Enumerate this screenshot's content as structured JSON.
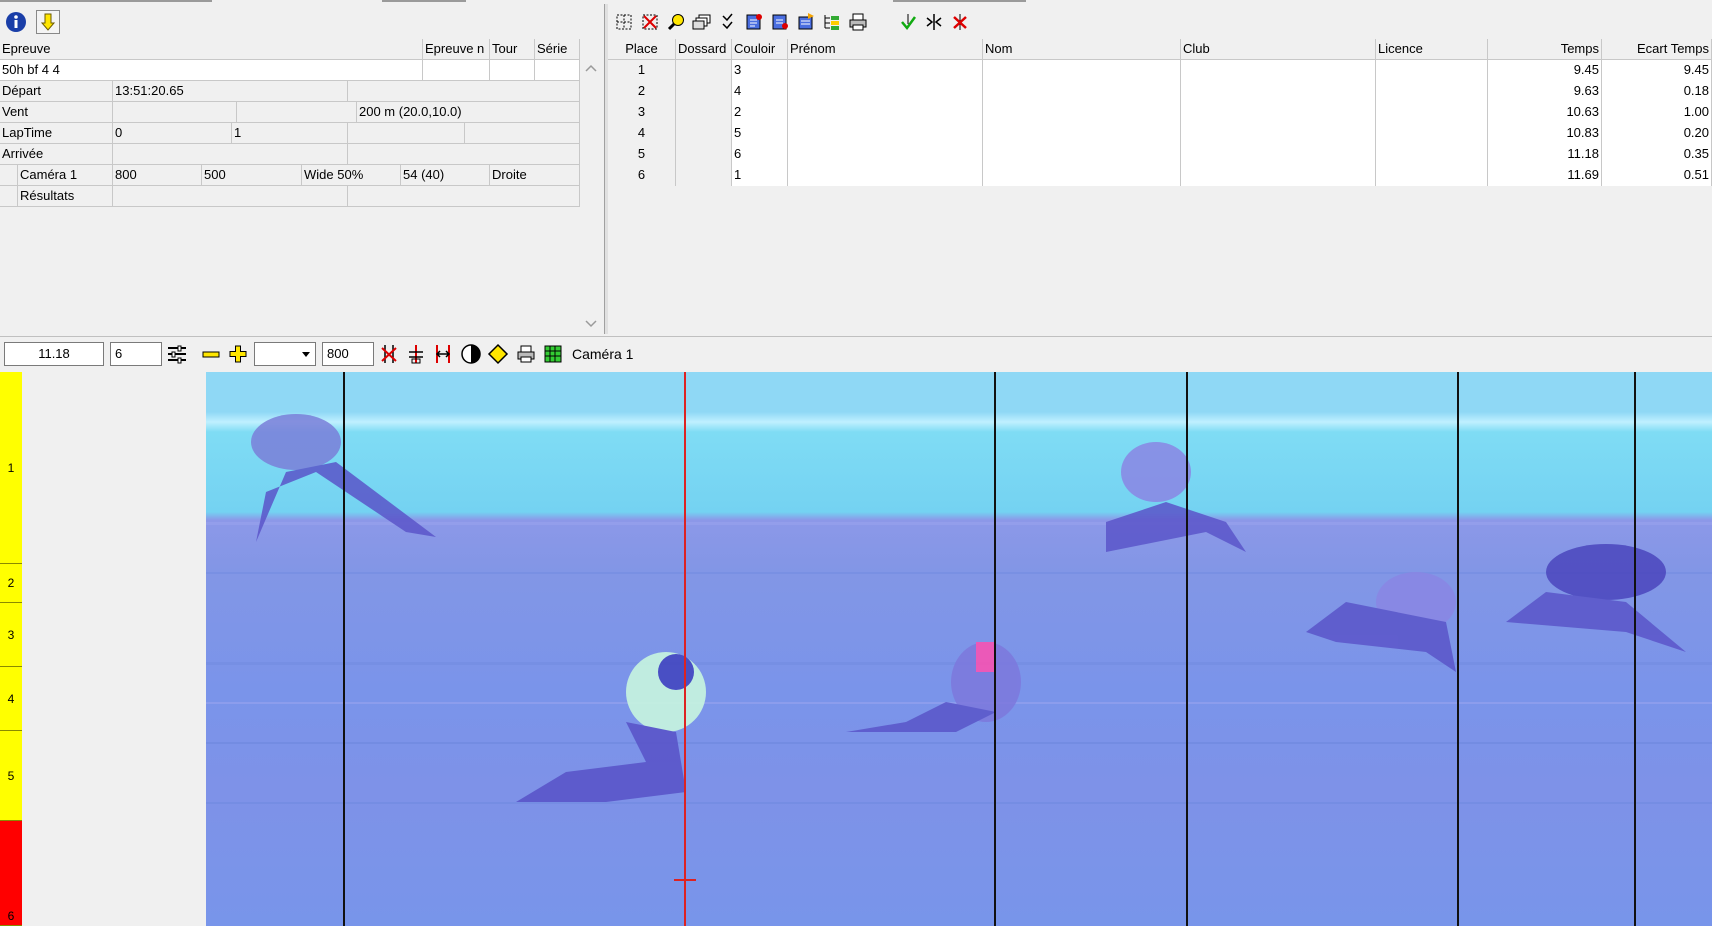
{
  "event_panel": {
    "toolbar": {
      "info_icon": "info-icon",
      "down_icon": "arrow-down-icon"
    },
    "headers": [
      "Epreuve",
      "Epreuve n",
      "Tour",
      "Série"
    ],
    "event_name": "50h bf 4 4",
    "rows": {
      "depart": {
        "label": "Départ",
        "value": "13:51:20.65"
      },
      "vent": {
        "label": "Vent",
        "value": "200 m (20.0,10.0)"
      },
      "laptime": {
        "label": "LapTime",
        "v1": "0",
        "v2": "1"
      },
      "arrivee": {
        "label": "Arrivée"
      },
      "camera": {
        "label": "Caméra 1",
        "v1": "800",
        "v2": "500",
        "v3": "Wide 50%",
        "v4": "54  (40)",
        "v5": "Droite"
      },
      "resultats": {
        "label": "Résultats"
      }
    }
  },
  "results_panel": {
    "headers": [
      "Place",
      "Dossard",
      "Couloir",
      "Prénom",
      "Nom",
      "Club",
      "Licence",
      "Temps",
      "Ecart Temps"
    ],
    "rows": [
      {
        "place": "1",
        "dossard": "",
        "couloir": "3",
        "prenom": "",
        "nom": "",
        "club": "",
        "licence": "",
        "temps": "9.45",
        "ecart": "9.45"
      },
      {
        "place": "2",
        "dossard": "",
        "couloir": "4",
        "prenom": "",
        "nom": "",
        "club": "",
        "licence": "",
        "temps": "9.63",
        "ecart": "0.18"
      },
      {
        "place": "3",
        "dossard": "",
        "couloir": "2",
        "prenom": "",
        "nom": "",
        "club": "",
        "licence": "",
        "temps": "10.63",
        "ecart": "1.00"
      },
      {
        "place": "4",
        "dossard": "",
        "couloir": "5",
        "prenom": "",
        "nom": "",
        "club": "",
        "licence": "",
        "temps": "10.83",
        "ecart": "0.20"
      },
      {
        "place": "5",
        "dossard": "",
        "couloir": "6",
        "prenom": "",
        "nom": "",
        "club": "",
        "licence": "",
        "temps": "11.18",
        "ecart": "0.35"
      },
      {
        "place": "6",
        "dossard": "",
        "couloir": "1",
        "prenom": "",
        "nom": "",
        "club": "",
        "licence": "",
        "temps": "11.69",
        "ecart": "0.51"
      }
    ]
  },
  "image_toolbar": {
    "time": "11.18",
    "lane_field": "6",
    "zoom_select": "",
    "width_field": "800",
    "camera_label": "Caméra 1"
  },
  "lanes": [
    {
      "label": "1",
      "color": "#ffff00"
    },
    {
      "label": "2",
      "color": "#ffff00"
    },
    {
      "label": "3",
      "color": "#ffff00"
    },
    {
      "label": "4",
      "color": "#ffff00"
    },
    {
      "label": "5",
      "color": "#ffff00"
    },
    {
      "label": "6",
      "color": "#ff0000"
    }
  ],
  "colors": {
    "finish_line": "#dd2222",
    "lane_yellow": "#ffff00",
    "lane_red": "#ff0000"
  }
}
